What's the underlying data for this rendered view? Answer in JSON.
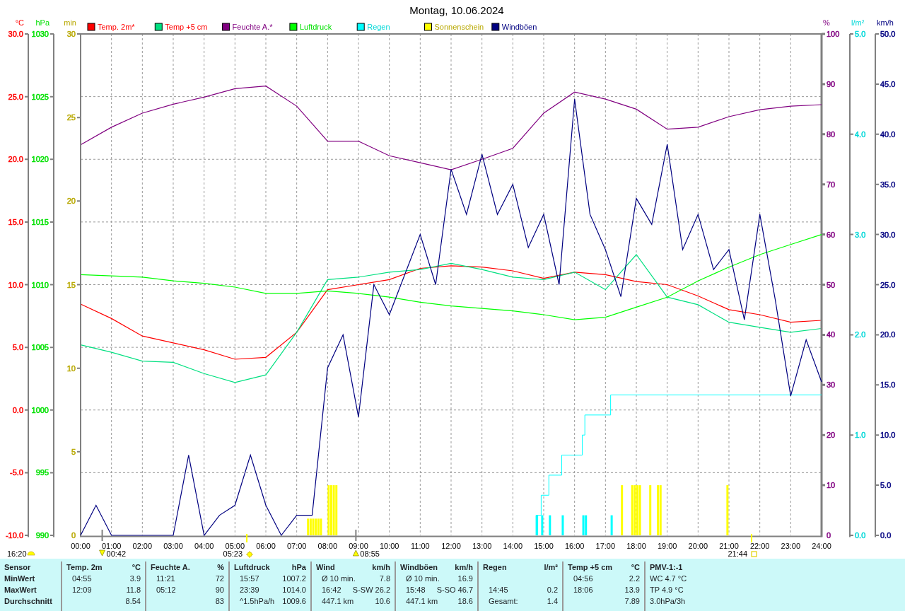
{
  "title": "Montag, 10.06.2024",
  "layers": [
    {
      "right_axis": false,
      "color": "#ff0000",
      "chart_data": {
        "type": "line",
        "ylabel": "°C",
        "grid": true,
        "legend": "top",
        "xlim": [
          0,
          24
        ],
        "ylim": [
          -10,
          30
        ],
        "xticks": [
          {
            "value": 0,
            "label": "00:00"
          },
          {
            "value": 1,
            "label": "01:00"
          },
          {
            "value": 2,
            "label": "02:00"
          },
          {
            "value": 3,
            "label": "03:00"
          },
          {
            "value": 4,
            "label": "04:00"
          },
          {
            "value": 5,
            "label": "05:00"
          },
          {
            "value": 6,
            "label": "06:00"
          },
          {
            "value": 7,
            "label": "07:00"
          },
          {
            "value": 8,
            "label": "08:00"
          },
          {
            "value": 9,
            "label": "09:00"
          },
          {
            "value": 10,
            "label": "10:00"
          },
          {
            "value": 11,
            "label": "11:00"
          },
          {
            "value": 12,
            "label": "12:00"
          },
          {
            "value": 13,
            "label": "13:00"
          },
          {
            "value": 14,
            "label": "14:00"
          },
          {
            "value": 15,
            "label": "15:00"
          },
          {
            "value": 16,
            "label": "16:00"
          },
          {
            "value": 17,
            "label": "17:00"
          },
          {
            "value": 18,
            "label": "18:00"
          },
          {
            "value": 19,
            "label": "19:00"
          },
          {
            "value": 20,
            "label": "20:00"
          },
          {
            "value": 21,
            "label": "21:00"
          },
          {
            "value": 22,
            "label": "22:00"
          },
          {
            "value": 23,
            "label": "23:00"
          },
          {
            "value": 24,
            "label": "24:00"
          }
        ],
        "yticks": [
          {
            "value": -10,
            "label": "-10.0"
          },
          {
            "value": -5,
            "label": "-5.0"
          },
          {
            "value": 0,
            "label": "0.0"
          },
          {
            "value": 5,
            "label": "5.0"
          },
          {
            "value": 10,
            "label": "10.0"
          },
          {
            "value": 15,
            "label": "15.0"
          },
          {
            "value": 20,
            "label": "20.0"
          },
          {
            "value": 25,
            "label": "25.0"
          },
          {
            "value": 30,
            "label": "30.0"
          }
        ],
        "series": [
          {
            "name": "Temp. 2m*",
            "color": "#ff0000",
            "x": [
              0,
              1,
              2,
              3,
              4,
              5,
              6,
              7,
              8,
              9,
              10,
              11,
              12,
              13,
              14,
              15,
              16,
              17,
              18,
              19,
              20,
              21,
              22,
              23,
              24
            ],
            "values": [
              8.45,
              7.3,
              5.9,
              5.35,
              4.8,
              4.05,
              4.2,
              6.2,
              9.6,
              10.0,
              10.4,
              11.3,
              11.5,
              11.4,
              11.1,
              10.5,
              11.0,
              10.8,
              10.25,
              10.0,
              9.1,
              8.0,
              7.6,
              7.0,
              7.15
            ]
          },
          {
            "name": "Temp +5 cm",
            "color": "#00e080",
            "x": [
              0,
              1,
              2,
              3,
              4,
              5,
              6,
              7,
              8,
              9,
              10,
              11,
              12,
              13,
              14,
              15,
              16,
              17,
              18,
              19,
              20,
              21,
              22,
              23,
              24
            ],
            "values": [
              5.2,
              4.6,
              3.9,
              3.8,
              2.9,
              2.2,
              2.8,
              6.2,
              10.4,
              10.6,
              11.0,
              11.2,
              11.7,
              11.2,
              10.6,
              10.4,
              11.0,
              9.6,
              12.4,
              9.0,
              8.4,
              7.0,
              6.6,
              6.2,
              6.5
            ]
          }
        ]
      }
    },
    {
      "right_axis": true,
      "color": "#800080",
      "chart_data": {
        "type": "line",
        "ylabel": "%",
        "legend": "top",
        "xlim": [
          0,
          24
        ],
        "ylim": [
          0,
          100
        ],
        "yticks": [
          {
            "value": 0,
            "label": "0"
          },
          {
            "value": 10,
            "label": "10"
          },
          {
            "value": 20,
            "label": "20"
          },
          {
            "value": 30,
            "label": "30"
          },
          {
            "value": 40,
            "label": "40"
          },
          {
            "value": 50,
            "label": "50"
          },
          {
            "value": 60,
            "label": "60"
          },
          {
            "value": 70,
            "label": "70"
          },
          {
            "value": 80,
            "label": "80"
          },
          {
            "value": 90,
            "label": "90"
          },
          {
            "value": 100,
            "label": "100"
          }
        ],
        "series": [
          {
            "name": "Feuchte A.*",
            "color": "#800080",
            "x": [
              0,
              1,
              2,
              3,
              4,
              5,
              6,
              7,
              8,
              9,
              10,
              11,
              12,
              13,
              14,
              15,
              16,
              17,
              18,
              19,
              20,
              21,
              22,
              23,
              24
            ],
            "values": [
              77.9,
              81.4,
              84.2,
              86,
              87.4,
              89.1,
              89.6,
              85.6,
              78.6,
              78.6,
              75.7,
              74.3,
              72.9,
              75,
              77.2,
              84.2,
              88.4,
              87,
              85,
              81,
              81.4,
              83.5,
              84.9,
              85.6,
              85.9
            ]
          }
        ]
      }
    },
    {
      "right_axis": false,
      "color": "#00e000",
      "chart_data": {
        "type": "line",
        "ylabel": "hPa",
        "legend": "top",
        "xlim": [
          0,
          24
        ],
        "ylim": [
          990,
          1030
        ],
        "yticks": [
          {
            "value": 990,
            "label": "990"
          },
          {
            "value": 995,
            "label": "995"
          },
          {
            "value": 1000,
            "label": "1000"
          },
          {
            "value": 1005,
            "label": "1005"
          },
          {
            "value": 1010,
            "label": "1010"
          },
          {
            "value": 1015,
            "label": "1015"
          },
          {
            "value": 1020,
            "label": "1020"
          },
          {
            "value": 1025,
            "label": "1025"
          },
          {
            "value": 1030,
            "label": "1030"
          }
        ],
        "series": [
          {
            "name": "Luftdruck",
            "color": "#00ff00",
            "x": [
              0,
              1,
              2,
              3,
              4,
              5,
              6,
              7,
              8,
              9,
              10,
              11,
              12,
              13,
              14,
              15,
              16,
              17,
              18,
              19,
              20,
              21,
              22,
              23,
              24
            ],
            "values": [
              1010.8,
              1010.7,
              1010.6,
              1010.3,
              1010.1,
              1009.8,
              1009.3,
              1009.3,
              1009.5,
              1009.3,
              1009.0,
              1008.6,
              1008.3,
              1008.1,
              1007.9,
              1007.6,
              1007.2,
              1007.4,
              1008.2,
              1009.0,
              1010.3,
              1011.4,
              1012.4,
              1013.2,
              1014.0
            ]
          }
        ]
      }
    },
    {
      "right_axis": true,
      "color": "#00d8d8",
      "cumulative_line": true,
      "chart_data": {
        "type": "bar",
        "ylabel": "l/m²",
        "legend": "top",
        "xlim": [
          0,
          24
        ],
        "ylim": [
          0,
          5
        ],
        "yticks": [
          {
            "value": 0,
            "label": "0.0"
          },
          {
            "value": 1,
            "label": "1.0"
          },
          {
            "value": 2,
            "label": "2.0"
          },
          {
            "value": 3,
            "label": "3.0"
          },
          {
            "value": 4,
            "label": "4.0"
          },
          {
            "value": 5,
            "label": "5.0"
          }
        ],
        "series": [
          {
            "name": "Regen",
            "color": "#00ffff",
            "x": [
              14.75,
              14.917,
              15.167,
              15.583,
              16.25,
              16.333,
              17.167
            ],
            "values": [
              0.2,
              0.2,
              0.2,
              0.2,
              0.2,
              0.2,
              0.2
            ]
          }
        ]
      }
    },
    {
      "right_axis": false,
      "color": "#b8a800",
      "chart_data": {
        "type": "bar",
        "ylabel": "min",
        "legend": "top",
        "xlim": [
          0,
          24
        ],
        "ylim": [
          0,
          30
        ],
        "yticks": [
          {
            "value": 0,
            "label": "0"
          },
          {
            "value": 5,
            "label": "5"
          },
          {
            "value": 10,
            "label": "10"
          },
          {
            "value": 15,
            "label": "15"
          },
          {
            "value": 20,
            "label": "20"
          },
          {
            "value": 25,
            "label": "25"
          },
          {
            "value": 30,
            "label": "30"
          }
        ],
        "series": [
          {
            "name": "Sonnenschein",
            "color": "#ffff00",
            "x": [
              7.333,
              7.417,
              7.5,
              7.583,
              7.667,
              7.75,
              8.0,
              8.083,
              8.167,
              8.25,
              17.5,
              17.833,
              17.917,
              18.0,
              18.083,
              18.417,
              18.667,
              18.75,
              20.917
            ],
            "values": [
              1,
              1,
              1,
              1,
              1,
              1,
              3,
              3,
              3,
              3,
              3,
              3,
              3,
              3,
              3,
              3,
              3,
              3,
              3
            ]
          }
        ]
      }
    },
    {
      "right_axis": true,
      "color": "#000080",
      "chart_data": {
        "type": "line",
        "ylabel": "km/h",
        "legend": "top",
        "xlim": [
          0,
          24
        ],
        "ylim": [
          0,
          50
        ],
        "yticks": [
          {
            "value": 0,
            "label": "0.0"
          },
          {
            "value": 5,
            "label": "5.0"
          },
          {
            "value": 10,
            "label": "10.0"
          },
          {
            "value": 15,
            "label": "15.0"
          },
          {
            "value": 20,
            "label": "20.0"
          },
          {
            "value": 25,
            "label": "25.0"
          },
          {
            "value": 30,
            "label": "30.0"
          },
          {
            "value": 35,
            "label": "35.0"
          },
          {
            "value": 40,
            "label": "40.0"
          },
          {
            "value": 45,
            "label": "45.0"
          },
          {
            "value": 50,
            "label": "50.0"
          }
        ],
        "series": [
          {
            "name": "Windböen",
            "color": "#000080",
            "x": [
              0,
              0.5,
              1,
              1.5,
              2,
              2.5,
              3,
              3.5,
              4,
              4.5,
              5,
              5.5,
              6,
              6.5,
              7,
              7.5,
              8,
              8.5,
              9,
              9.5,
              10,
              10.5,
              11,
              11.5,
              12,
              12.5,
              13,
              13.5,
              14,
              14.5,
              15,
              15.5,
              16,
              16.5,
              17,
              17.5,
              18,
              18.5,
              19,
              19.5,
              20,
              20.5,
              21,
              21.5,
              22,
              22.5,
              23,
              23.5,
              24
            ],
            "values": [
              0,
              3,
              0,
              0,
              0,
              0,
              0,
              8,
              0,
              2,
              3,
              8,
              3,
              0,
              2,
              2,
              16.7,
              20,
              11.8,
              25,
              22,
              26,
              30,
              25,
              36.5,
              32,
              38,
              32,
              35,
              28.7,
              32,
              25,
              43.5,
              32,
              28.5,
              23.8,
              33.6,
              31,
              39,
              28.5,
              32,
              26.5,
              28.5,
              21.5,
              32,
              23.5,
              13.9,
              19.5,
              15.3
            ]
          }
        ]
      }
    }
  ],
  "events": [
    {
      "kind": "moonphase",
      "label": "16:20"
    },
    {
      "kind": "moonset",
      "label": "00:42"
    },
    {
      "kind": "sunrise",
      "label": "05:23"
    },
    {
      "kind": "moonrise",
      "label": "08:55"
    },
    {
      "kind": "sunset",
      "label": "21:44"
    }
  ],
  "stats": {
    "header": "Sensor",
    "row_labels": [
      "MinWert",
      "MaxWert",
      "Durchschnitt"
    ],
    "sections": [
      {
        "name": "Temp. 2m",
        "unit": "°C",
        "rows": [
          [
            "04:55",
            "3.9"
          ],
          [
            "12:09",
            "11.8"
          ],
          [
            null,
            "8.54"
          ]
        ]
      },
      {
        "name": "Feuchte A.",
        "unit": "%",
        "rows": [
          [
            "11:21",
            "72"
          ],
          [
            "05:12",
            "90"
          ],
          [
            null,
            "83"
          ]
        ]
      },
      {
        "name": "Luftdruck",
        "unit": "hPa",
        "rows": [
          [
            "15:57",
            "1007.2"
          ],
          [
            "23:39",
            "1014.0"
          ],
          [
            "^1.5hPa/h",
            "1009.6"
          ]
        ]
      },
      {
        "name": "Wind",
        "unit": "km/h",
        "rows": [
          [
            "Ø 10 min.",
            "7.8"
          ],
          [
            "16:42",
            "S-SW 26.2"
          ],
          [
            "447.1 km",
            "10.6"
          ]
        ]
      },
      {
        "name": "Windböen",
        "unit": "km/h",
        "rows": [
          [
            "Ø 10 min.",
            "16.9"
          ],
          [
            "15:48",
            "S-SO 46.7"
          ],
          [
            "447.1 km",
            "18.6"
          ]
        ]
      },
      {
        "name": "Regen",
        "unit": "l/m²",
        "rows": [
          [
            null,
            null
          ],
          [
            "14:45",
            "0.2"
          ],
          [
            "Gesamt:",
            "1.4"
          ]
        ]
      },
      {
        "name": "Temp +5 cm",
        "unit": "°C",
        "rows": [
          [
            "04:56",
            "2.2"
          ],
          [
            "18:06",
            "13.9"
          ],
          [
            null,
            "7.89"
          ]
        ]
      },
      {
        "name": "PMV-1:-1",
        "rows": [
          [
            "WC 4.7 °C"
          ],
          [
            "TP 4.9 °C"
          ],
          [
            "3.0hPa/3h"
          ]
        ]
      }
    ]
  }
}
